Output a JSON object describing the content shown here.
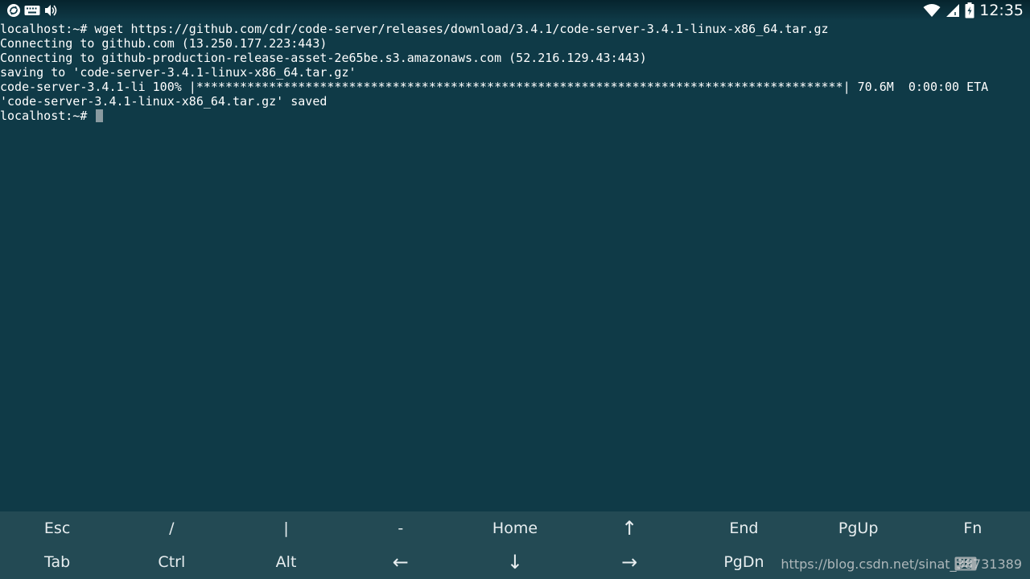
{
  "status_bar": {
    "time": "12:35",
    "icons_left": [
      "sync-icon",
      "keyboard-icon",
      "volume-icon"
    ],
    "icons_right": [
      "wifi-icon",
      "cell-signal-icon",
      "battery-icon"
    ]
  },
  "terminal": {
    "lines": [
      "localhost:~# wget https://github.com/cdr/code-server/releases/download/3.4.1/code-server-3.4.1-linux-x86_64.tar.gz",
      "Connecting to github.com (13.250.177.223:443)",
      "Connecting to github-production-release-asset-2e65be.s3.amazonaws.com (52.216.129.43:443)",
      "saving to 'code-server-3.4.1-linux-x86_64.tar.gz'",
      "code-server-3.4.1-li 100% |*****************************************************************************************| 70.6M  0:00:00 ETA",
      "'code-server-3.4.1-linux-x86_64.tar.gz' saved"
    ],
    "prompt": "localhost:~# "
  },
  "extra_keys": {
    "row1": [
      "Esc",
      "/",
      "|",
      "-",
      "Home",
      "↑",
      "End",
      "PgUp",
      "Fn"
    ],
    "row2": [
      "Tab",
      "Ctrl",
      "Alt",
      "←",
      "↓",
      "→",
      "PgDn",
      "",
      ""
    ]
  },
  "watermark": "https://blog.csdn.net/sinat_38731389",
  "colors": {
    "background": "#0f3a47",
    "keys_background": "#234a54",
    "text": "#ffffff"
  }
}
